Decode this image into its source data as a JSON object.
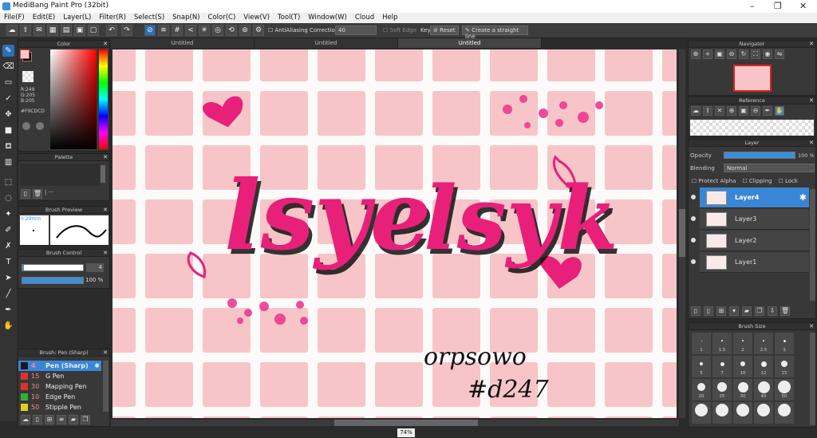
{
  "title": "MediBang Paint Pro (32bit)",
  "window_controls": {
    "minimize": "–",
    "maximize": "❐",
    "close": "✕"
  },
  "menu": [
    "File(F)",
    "Edit(E)",
    "Layer(L)",
    "Filter(R)",
    "Select(S)",
    "Snap(N)",
    "Color(C)",
    "View(V)",
    "Tool(T)",
    "Window(W)",
    "Cloud",
    "Help"
  ],
  "toolbar": {
    "antialias": "AntiAliasing",
    "correction_label": "Correction",
    "correction_value": "40",
    "soft_edge": "Soft Edge",
    "key": "Key",
    "reset": "Reset",
    "straight_line": "Create a straight line"
  },
  "tabs": [
    "Untitled",
    "Untitled",
    "Untitled"
  ],
  "color_panel": {
    "title": "Color",
    "r": "R:249",
    "g": "G:205",
    "b": "B:205",
    "hex": "#F9CDCD",
    "fg": "#F9CDCD",
    "bg": "#000000"
  },
  "palette_panel": {
    "title": "Palette",
    "hint": "| ···"
  },
  "brush_preview": {
    "title": "Brush Preview",
    "size": "0.29mm"
  },
  "brush_control": {
    "title": "Brush Control",
    "size": "4",
    "opacity": "100 %"
  },
  "brush_panel": {
    "title": "Brush: Pen (Sharp)",
    "items": [
      {
        "size": "4",
        "name": "Pen (Sharp)",
        "color": "#1a1a1a"
      },
      {
        "size": "15",
        "name": "G Pen",
        "color": "#e03030"
      },
      {
        "size": "30",
        "name": "Mapping Pen",
        "color": "#e03030"
      },
      {
        "size": "10",
        "name": "Edge Pen",
        "color": "#30b030"
      },
      {
        "size": "50",
        "name": "Stipple Pen",
        "color": "#e0d020"
      }
    ]
  },
  "navigator": {
    "title": "Navigator"
  },
  "reference": {
    "title": "Reference"
  },
  "layer_panel": {
    "title": "Layer",
    "opacity_label": "Opacity",
    "opacity_value": "100 %",
    "blending_label": "Blending",
    "blending_value": "Normal",
    "protect_alpha": "Protect Alpha",
    "clipping": "Clipping",
    "lock": "Lock",
    "layers": [
      "Layer4",
      "Layer3",
      "Layer2",
      "Layer1"
    ]
  },
  "brush_size": {
    "title": "Brush Size",
    "labels": [
      "1",
      "1.5",
      "2",
      "2.5",
      "3",
      "5",
      "7",
      "10",
      "12",
      "15",
      "20",
      "25",
      "30",
      "40",
      "50"
    ]
  },
  "canvas": {
    "text1": "lsye",
    "text2": "lsyk",
    "sig1": "orpsowo",
    "sig2": "#d247"
  },
  "status": {
    "zoom": "74%"
  }
}
